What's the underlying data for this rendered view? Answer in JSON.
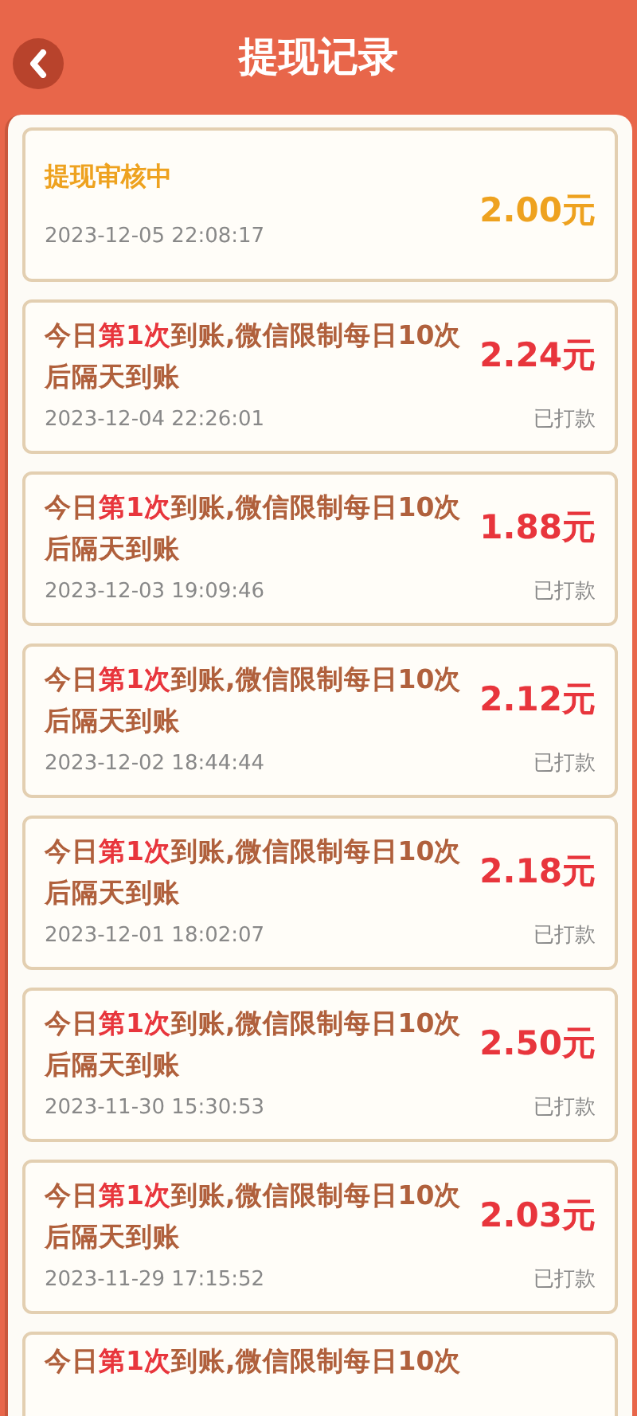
{
  "header": {
    "title": "提现记录"
  },
  "records": [
    {
      "kind": "pending",
      "title": "提现审核中",
      "amount": "2.00元",
      "time": "2023-12-05 22:08:17"
    },
    {
      "kind": "paid",
      "message": [
        {
          "text": "今日",
          "highlight": false
        },
        {
          "text": "第1次",
          "highlight": true
        },
        {
          "text": "到账,微信限制每日10次后隔天到账",
          "highlight": false
        }
      ],
      "amount": "2.24元",
      "time": "2023-12-04 22:26:01",
      "status": "已打款"
    },
    {
      "kind": "paid",
      "message": [
        {
          "text": "今日",
          "highlight": false
        },
        {
          "text": "第1次",
          "highlight": true
        },
        {
          "text": "到账,微信限制每日10次后隔天到账",
          "highlight": false
        }
      ],
      "amount": "1.88元",
      "time": "2023-12-03 19:09:46",
      "status": "已打款"
    },
    {
      "kind": "paid",
      "message": [
        {
          "text": "今日",
          "highlight": false
        },
        {
          "text": "第1次",
          "highlight": true
        },
        {
          "text": "到账,微信限制每日10次后隔天到账",
          "highlight": false
        }
      ],
      "amount": "2.12元",
      "time": "2023-12-02 18:44:44",
      "status": "已打款"
    },
    {
      "kind": "paid",
      "message": [
        {
          "text": "今日",
          "highlight": false
        },
        {
          "text": "第1次",
          "highlight": true
        },
        {
          "text": "到账,微信限制每日10次后隔天到账",
          "highlight": false
        }
      ],
      "amount": "2.18元",
      "time": "2023-12-01 18:02:07",
      "status": "已打款"
    },
    {
      "kind": "paid",
      "message": [
        {
          "text": "今日",
          "highlight": false
        },
        {
          "text": "第1次",
          "highlight": true
        },
        {
          "text": "到账,微信限制每日10次后隔天到账",
          "highlight": false
        }
      ],
      "amount": "2.50元",
      "time": "2023-11-30 15:30:53",
      "status": "已打款"
    },
    {
      "kind": "paid",
      "message": [
        {
          "text": "今日",
          "highlight": false
        },
        {
          "text": "第1次",
          "highlight": true
        },
        {
          "text": "到账,微信限制每日10次后隔天到账",
          "highlight": false
        }
      ],
      "amount": "2.03元",
      "time": "2023-11-29 17:15:52",
      "status": "已打款"
    },
    {
      "kind": "partial",
      "message": [
        {
          "text": "今日",
          "highlight": false
        },
        {
          "text": "第1次",
          "highlight": true
        },
        {
          "text": "到账,微信限制每日10次",
          "highlight": false
        }
      ]
    }
  ]
}
